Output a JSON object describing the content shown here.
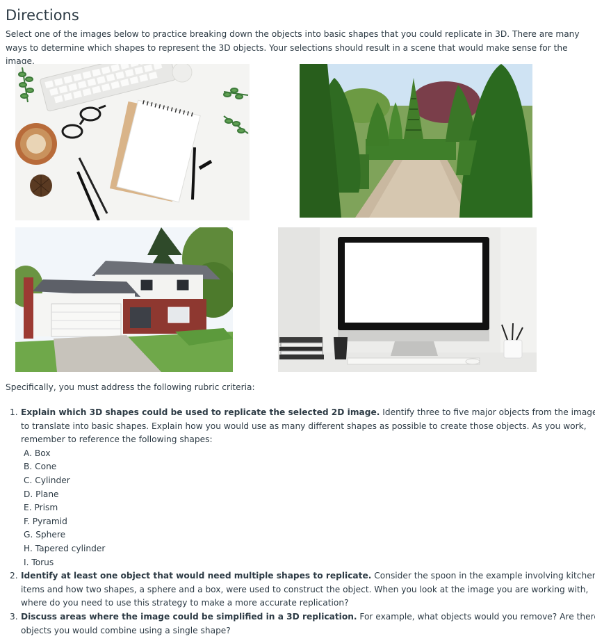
{
  "heading": "Directions",
  "intro": "Select one of the images below to practice breaking down the objects into basic shapes that you could replicate in 3D. There are many ways to determine which shapes to represent the 3D objects. Your selections should result in a scene that would make sense for the image.",
  "criteria_intro": "Specifically, you must address the following rubric criteria:",
  "items": [
    {
      "num": "1.",
      "bold": "Explain which 3D shapes could be used to replicate the selected 2D image.",
      "text": " Identify three to five major objects from the image to translate into basic shapes. Explain how you would use as many different shapes as possible to create those objects. As you work, remember to reference the following shapes:"
    },
    {
      "num": "2.",
      "bold": "Identify at least one object that would need multiple shapes to replicate.",
      "text": " Consider the spoon in the example involving kitchen items and how two shapes, a sphere and a box, were used to construct the object. When you look at the image you are working with, where do you need to use this strategy to make a more accurate replication?"
    },
    {
      "num": "3.",
      "bold": "Discuss areas where the image could be simplified in a 3D replication.",
      "text": " For example, what objects would you remove? Are there objects you would combine using a single shape?"
    }
  ],
  "shapes": [
    "A. Box",
    "B. Cone",
    "C. Cylinder",
    "D. Plane",
    "E. Prism",
    "F. Pyramid",
    "G. Sphere",
    "H. Tapered cylinder",
    "I. Torus"
  ]
}
